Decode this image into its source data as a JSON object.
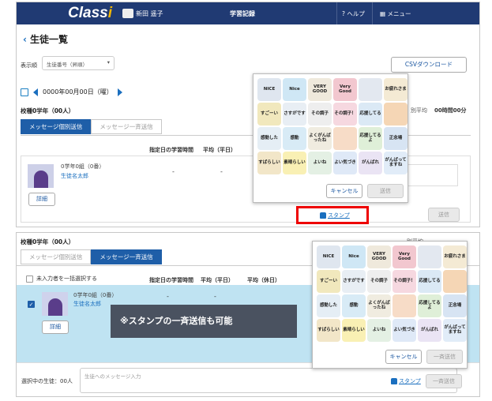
{
  "header": {
    "logo_main": "Class",
    "logo_i": "i",
    "user_name": "新田 遥子",
    "title": "学習記録",
    "help": "ヘルプ",
    "menu": "メニュー",
    "help_icon": "?",
    "menu_icon": "grid-icon"
  },
  "page": {
    "title": "生徒一覧",
    "back": "‹"
  },
  "sort": {
    "label": "表示順",
    "value": "生徒番号（昇順）"
  },
  "csv_label": "CSVダウンロード",
  "date": "0000年00月00日（曜）",
  "section_title": "校種0学年（00人）",
  "tabs": {
    "individual": "メッセージ個別送信",
    "bulk": "メッセージ一斉送信"
  },
  "columns": {
    "study_time": "指定日の学習時間",
    "avg_weekday": "平均（平日）",
    "avg_holiday": "平均（休日）",
    "avg_partial": "別平均",
    "avg_value": "00時間00分"
  },
  "student": {
    "class": "0学年0組（0番）",
    "name": "生徒名太郎",
    "detail": "詳細",
    "dash": "-"
  },
  "stamp_popup": {
    "cancel": "キャンセル",
    "send": "送信"
  },
  "stamps": [
    {
      "label": "NICE",
      "bg": "#dfe6ef"
    },
    {
      "label": "Nice",
      "bg": "#cfe7f5"
    },
    {
      "label": "VERY GOOD",
      "bg": "#efe9dc"
    },
    {
      "label": "Very Good",
      "bg": "#f2c7cf"
    },
    {
      "label": "",
      "bg": "#e3e8f0"
    },
    {
      "label": "お疲れさま",
      "bg": "#f4ead4"
    },
    {
      "label": "すごーい",
      "bg": "#f1e8bd"
    },
    {
      "label": "さすがです",
      "bg": "#e8eef4"
    },
    {
      "label": "その調子",
      "bg": "#eeeeee"
    },
    {
      "label": "その調子！",
      "bg": "#f6d8e0"
    },
    {
      "label": "応援してる",
      "bg": "#dbe9f5"
    },
    {
      "label": "",
      "bg": "#f5d6b5"
    },
    {
      "label": "感動した",
      "bg": "#e5eef5"
    },
    {
      "label": "感動",
      "bg": "#d8ebf6"
    },
    {
      "label": "よくがんばったね",
      "bg": "#f0ece0"
    },
    {
      "label": "",
      "bg": "#f7dcc7"
    },
    {
      "label": "応援してるよ",
      "bg": "#dfefd8"
    },
    {
      "label": "正念場",
      "bg": "#d7e4f3"
    },
    {
      "label": "すばらしい",
      "bg": "#f2e6c8"
    },
    {
      "label": "素晴らしい",
      "bg": "#f9f0b4"
    },
    {
      "label": "よいね",
      "bg": "#e4f0e4"
    },
    {
      "label": "よい気づき",
      "bg": "#dfe9f7"
    },
    {
      "label": "がんばれ",
      "bg": "#eae4f4"
    },
    {
      "label": "がんばってますね",
      "bg": "#e1ecf8"
    }
  ],
  "stamp_link": "スタンプ",
  "send_button": "送信",
  "bulk": {
    "section_title": "校種0学年（00人）",
    "select_all": "未入力者を一括選択する",
    "avg_holiday_label": "平均（休日）",
    "partial_text": "別平均",
    "overlay_note": "※スタンプの一斉送信も可能",
    "selected_label": "選択中の生徒：00人",
    "message_placeholder": "生徒へのメッセージ入力",
    "bulk_send": "一斉送信",
    "checkmark": "✓"
  }
}
